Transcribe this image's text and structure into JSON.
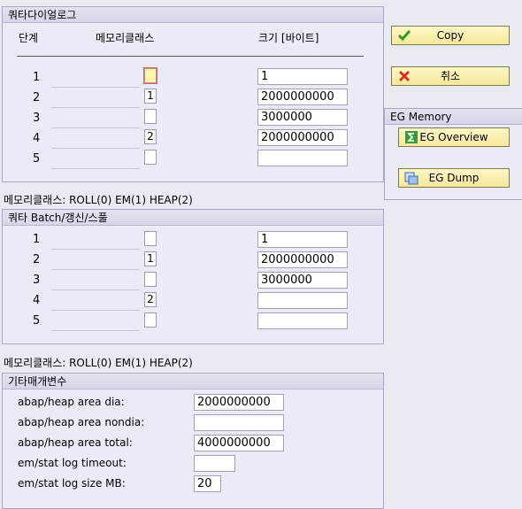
{
  "dialog_group": {
    "title": "쿼타다이얼로그",
    "headers": {
      "step": "단계",
      "memclass": "메모리클래스",
      "size": "크기 [바이트]"
    },
    "rows": [
      {
        "step": "1",
        "memclass": "",
        "size": "1"
      },
      {
        "step": "2",
        "memclass": "1",
        "size": "2000000000"
      },
      {
        "step": "3",
        "memclass": "",
        "size": "3000000"
      },
      {
        "step": "4",
        "memclass": "2",
        "size": "2000000000"
      },
      {
        "step": "5",
        "memclass": "",
        "size": ""
      }
    ]
  },
  "legend_1": "메모리클래스: ROLL(0) EM(1) HEAP(2)",
  "batch_group": {
    "title": "쿼타 Batch/갱신/스풀",
    "rows": [
      {
        "step": "1",
        "memclass": "",
        "size": "1"
      },
      {
        "step": "2",
        "memclass": "1",
        "size": "2000000000"
      },
      {
        "step": "3",
        "memclass": "",
        "size": "3000000"
      },
      {
        "step": "4",
        "memclass": "2",
        "size": ""
      },
      {
        "step": "5",
        "memclass": "",
        "size": ""
      }
    ]
  },
  "legend_2": "메모리클래스: ROLL(0) EM(1) HEAP(2)",
  "other_group": {
    "title": "기타매개변수",
    "params": [
      {
        "label": "abap/heap area dia:",
        "value": "2000000000"
      },
      {
        "label": "abap/heap area nondia:",
        "value": ""
      },
      {
        "label": "abap/heap area total:",
        "value": "4000000000"
      },
      {
        "label": "em/stat log timeout:",
        "value": ""
      },
      {
        "label": "em/stat log size MB:",
        "value": "20"
      }
    ]
  },
  "buttons": {
    "copy": "Copy",
    "cancel": "취소"
  },
  "eg_memory": {
    "title": "EG Memory",
    "overview": "EG Overview",
    "dump": "EG Dump"
  },
  "icons": {
    "copy": "checkmark-icon",
    "cancel": "cross-icon",
    "overview": "sigma-icon",
    "dump": "dump-icon"
  },
  "colors": {
    "button_bg": "#f7e9a0",
    "panel_bg": "#ebebf5",
    "border": "#a9a6c6"
  }
}
